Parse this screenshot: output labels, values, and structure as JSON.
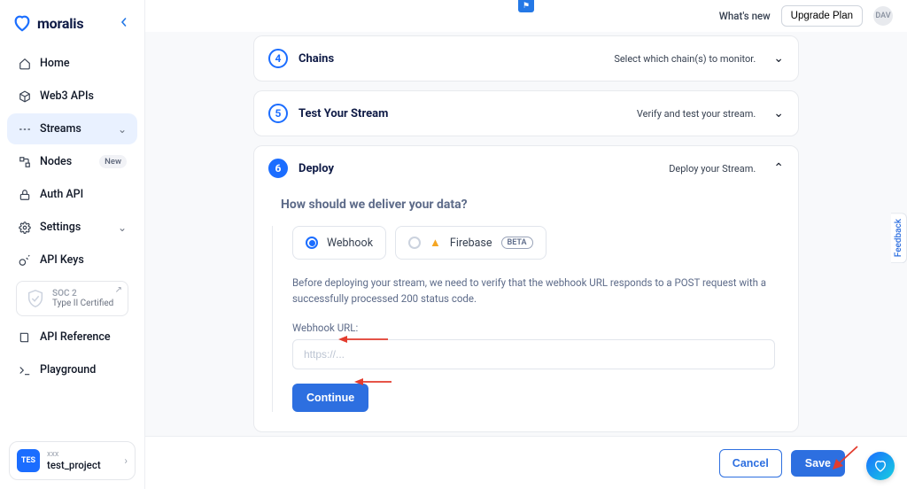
{
  "brand": {
    "name": "moralis"
  },
  "sidebar": {
    "items": [
      {
        "label": "Home"
      },
      {
        "label": "Web3 APIs"
      },
      {
        "label": "Streams"
      },
      {
        "label": "Nodes",
        "badge": "New"
      },
      {
        "label": "Auth API"
      },
      {
        "label": "Settings"
      },
      {
        "label": "API Keys"
      }
    ],
    "soc2": {
      "line1": "SOC 2",
      "line2": "Type II Certified"
    },
    "secondary": [
      {
        "label": "API Reference"
      },
      {
        "label": "Playground"
      }
    ],
    "project": {
      "badge": "TES",
      "line1": "xxx",
      "line2": "test_project"
    }
  },
  "topbar": {
    "whats_new": "What's new",
    "upgrade": "Upgrade Plan",
    "avatar": "DAV"
  },
  "steps": {
    "chains": {
      "num": "4",
      "title": "Chains",
      "hint": "Select which chain(s) to monitor."
    },
    "test": {
      "num": "5",
      "title": "Test Your Stream",
      "hint": "Verify and test your stream."
    },
    "deploy": {
      "num": "6",
      "title": "Deploy",
      "hint": "Deploy your Stream.",
      "question": "How should we deliver your data?",
      "webhook_label": "Webhook",
      "firebase_label": "Firebase",
      "beta": "BETA",
      "help": "Before deploying your stream, we need to verify that the webhook URL responds to a POST request with a successfully processed 200 status code.",
      "url_label": "Webhook URL:",
      "url_placeholder": "https://...",
      "continue": "Continue"
    }
  },
  "footer": {
    "cancel": "Cancel",
    "save": "Save"
  },
  "feedback": "Feedback"
}
